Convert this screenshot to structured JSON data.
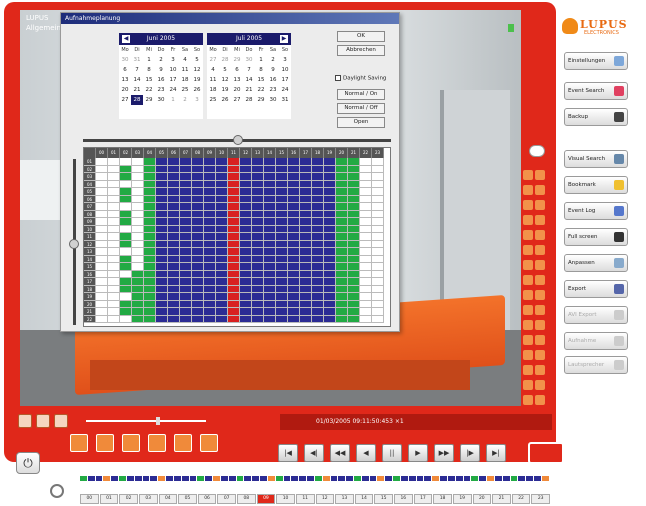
{
  "camera": {
    "label": "LUPUS",
    "sublabel": "Allgemein"
  },
  "dialog": {
    "title": "Aufnahmeplanung",
    "buttons": {
      "ok": "OK",
      "cancel": "Abbrechen",
      "normal1": "Normal / On",
      "normal2": "Normal / Off",
      "open": "Open"
    },
    "daylight_label": "Daylight Saving",
    "calendars": [
      {
        "month": "Juni 2005",
        "dow": [
          "Mo",
          "Di",
          "Mi",
          "Do",
          "Fr",
          "Sa",
          "So"
        ],
        "days": [
          "30",
          "31",
          "1",
          "2",
          "3",
          "4",
          "5",
          "6",
          "7",
          "8",
          "9",
          "10",
          "11",
          "12",
          "13",
          "14",
          "15",
          "16",
          "17",
          "18",
          "19",
          "20",
          "21",
          "22",
          "23",
          "24",
          "25",
          "26",
          "27",
          "28",
          "29",
          "30",
          "1",
          "2",
          "3"
        ]
      },
      {
        "month": "Juli 2005",
        "dow": [
          "Mo",
          "Di",
          "Mi",
          "Do",
          "Fr",
          "Sa",
          "So"
        ],
        "days": [
          "27",
          "28",
          "29",
          "30",
          "1",
          "2",
          "3",
          "4",
          "5",
          "6",
          "7",
          "8",
          "9",
          "10",
          "11",
          "12",
          "13",
          "14",
          "15",
          "16",
          "17",
          "18",
          "19",
          "20",
          "21",
          "22",
          "23",
          "24",
          "25",
          "26",
          "27",
          "28",
          "29",
          "30",
          "31"
        ]
      }
    ],
    "schedule": {
      "hours": [
        "00",
        "01",
        "02",
        "03",
        "04",
        "05",
        "06",
        "07",
        "08",
        "09",
        "10",
        "11",
        "12",
        "13",
        "14",
        "15",
        "16",
        "17",
        "18",
        "19",
        "20",
        "21",
        "22",
        "23"
      ],
      "rows": [
        "01",
        "02",
        "03",
        "04",
        "05",
        "06",
        "07",
        "08",
        "09",
        "10",
        "11",
        "12",
        "13",
        "14",
        "15",
        "16",
        "17",
        "18",
        "19",
        "20",
        "21",
        "22"
      ]
    }
  },
  "sidebar": {
    "logo": "LUPUS",
    "logo_sub": "ELECTRONICS",
    "buttons": [
      {
        "label": "Einstellungen"
      },
      {
        "label": "Event Search"
      },
      {
        "label": "Backup"
      },
      {
        "label": "Visual Search"
      },
      {
        "label": "Bookmark"
      },
      {
        "label": "Event Log"
      },
      {
        "label": "Full screen"
      },
      {
        "label": "Anpassen"
      },
      {
        "label": "Export"
      },
      {
        "label": "AVI Export"
      },
      {
        "label": "Aufnahme"
      },
      {
        "label": "Lautsprecher"
      }
    ]
  },
  "status": {
    "text": "01/03/2005 09:11:50:453   ×1"
  },
  "playback": [
    "|◀",
    "◀|",
    "◀◀",
    "◀",
    "||",
    "▶",
    "▶▶",
    "|▶",
    "▶|"
  ],
  "export_label": "Export",
  "timeline_hours": [
    "00",
    "01",
    "02",
    "03",
    "04",
    "05",
    "06",
    "07",
    "08",
    "09",
    "10",
    "11",
    "12",
    "13",
    "14",
    "15",
    "16",
    "17",
    "18",
    "19",
    "20",
    "21",
    "22",
    "23"
  ],
  "current_hour": "09"
}
